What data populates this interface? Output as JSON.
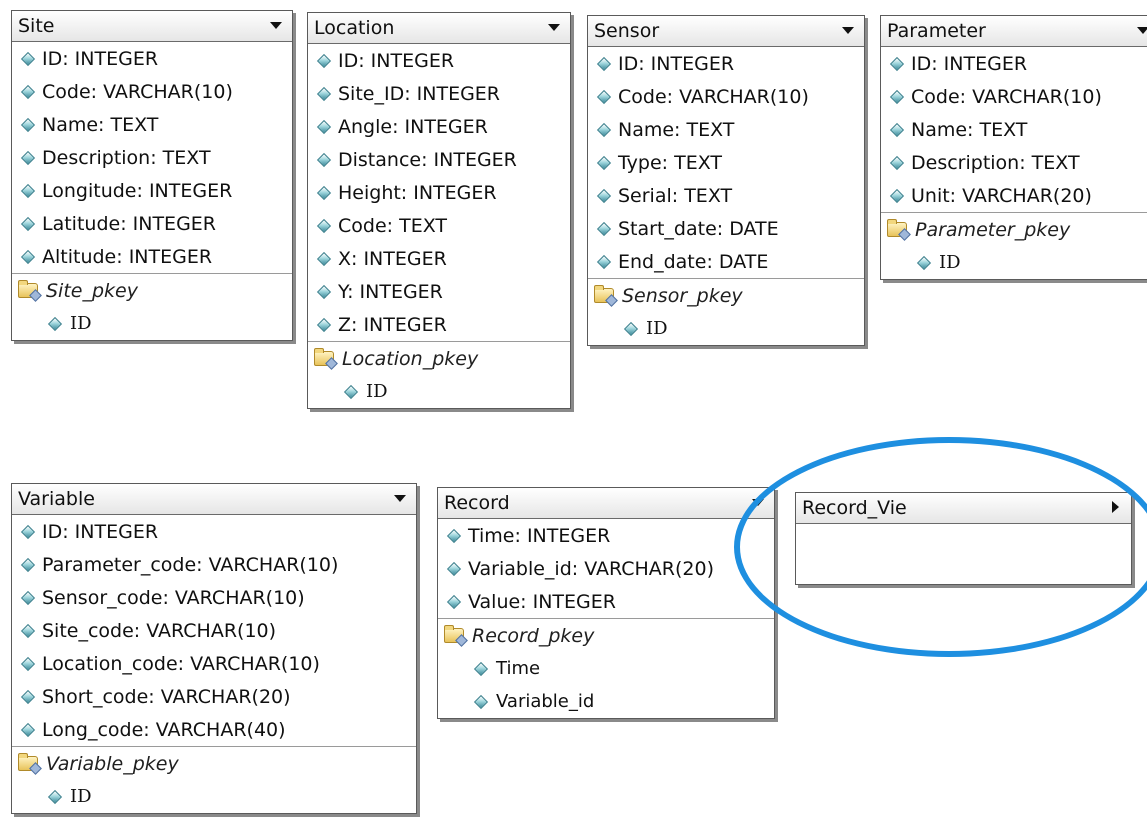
{
  "tables": {
    "site": {
      "title": "Site",
      "fields": [
        "ID: INTEGER",
        "Code: VARCHAR(10)",
        "Name: TEXT",
        "Description: TEXT",
        "Longitude: INTEGER",
        "Latitude: INTEGER",
        "Altitude: INTEGER"
      ],
      "pkey": "Site_pkey",
      "pkey_fields": [
        "ID"
      ]
    },
    "location": {
      "title": "Location",
      "fields": [
        "ID: INTEGER",
        "Site_ID: INTEGER",
        "Angle: INTEGER",
        "Distance: INTEGER",
        "Height: INTEGER",
        "Code: TEXT",
        "X: INTEGER",
        "Y: INTEGER",
        "Z: INTEGER"
      ],
      "pkey": "Location_pkey",
      "pkey_fields": [
        "ID"
      ]
    },
    "sensor": {
      "title": "Sensor",
      "fields": [
        "ID: INTEGER",
        "Code: VARCHAR(10)",
        "Name: TEXT",
        "Type: TEXT",
        "Serial: TEXT",
        "Start_date: DATE",
        "End_date: DATE"
      ],
      "pkey": "Sensor_pkey",
      "pkey_fields": [
        "ID"
      ]
    },
    "parameter": {
      "title": "Parameter",
      "fields": [
        "ID: INTEGER",
        "Code: VARCHAR(10)",
        "Name: TEXT",
        "Description: TEXT",
        "Unit: VARCHAR(20)"
      ],
      "pkey": "Parameter_pkey",
      "pkey_fields": [
        "ID"
      ]
    },
    "variable": {
      "title": "Variable",
      "fields": [
        "ID: INTEGER",
        "Parameter_code: VARCHAR(10)",
        "Sensor_code: VARCHAR(10)",
        "Site_code: VARCHAR(10)",
        "Location_code: VARCHAR(10)",
        "Short_code: VARCHAR(20)",
        "Long_code: VARCHAR(40)"
      ],
      "pkey": "Variable_pkey",
      "pkey_fields": [
        "ID"
      ]
    },
    "record": {
      "title": "Record",
      "fields": [
        "Time: INTEGER",
        "Variable_id: VARCHAR(20)",
        "Value: INTEGER"
      ],
      "pkey": "Record_pkey",
      "pkey_fields": [
        "Time",
        "Variable_id"
      ]
    },
    "record_view": {
      "title": "Record_Vie"
    }
  },
  "icons": {
    "header_dropdown": "chevron-down-icon",
    "header_collapsed": "chevron-right-icon",
    "field": "field-diamond-icon",
    "primary_key": "key-folder-icon"
  },
  "colors": {
    "highlight": "#1e8fe0"
  }
}
